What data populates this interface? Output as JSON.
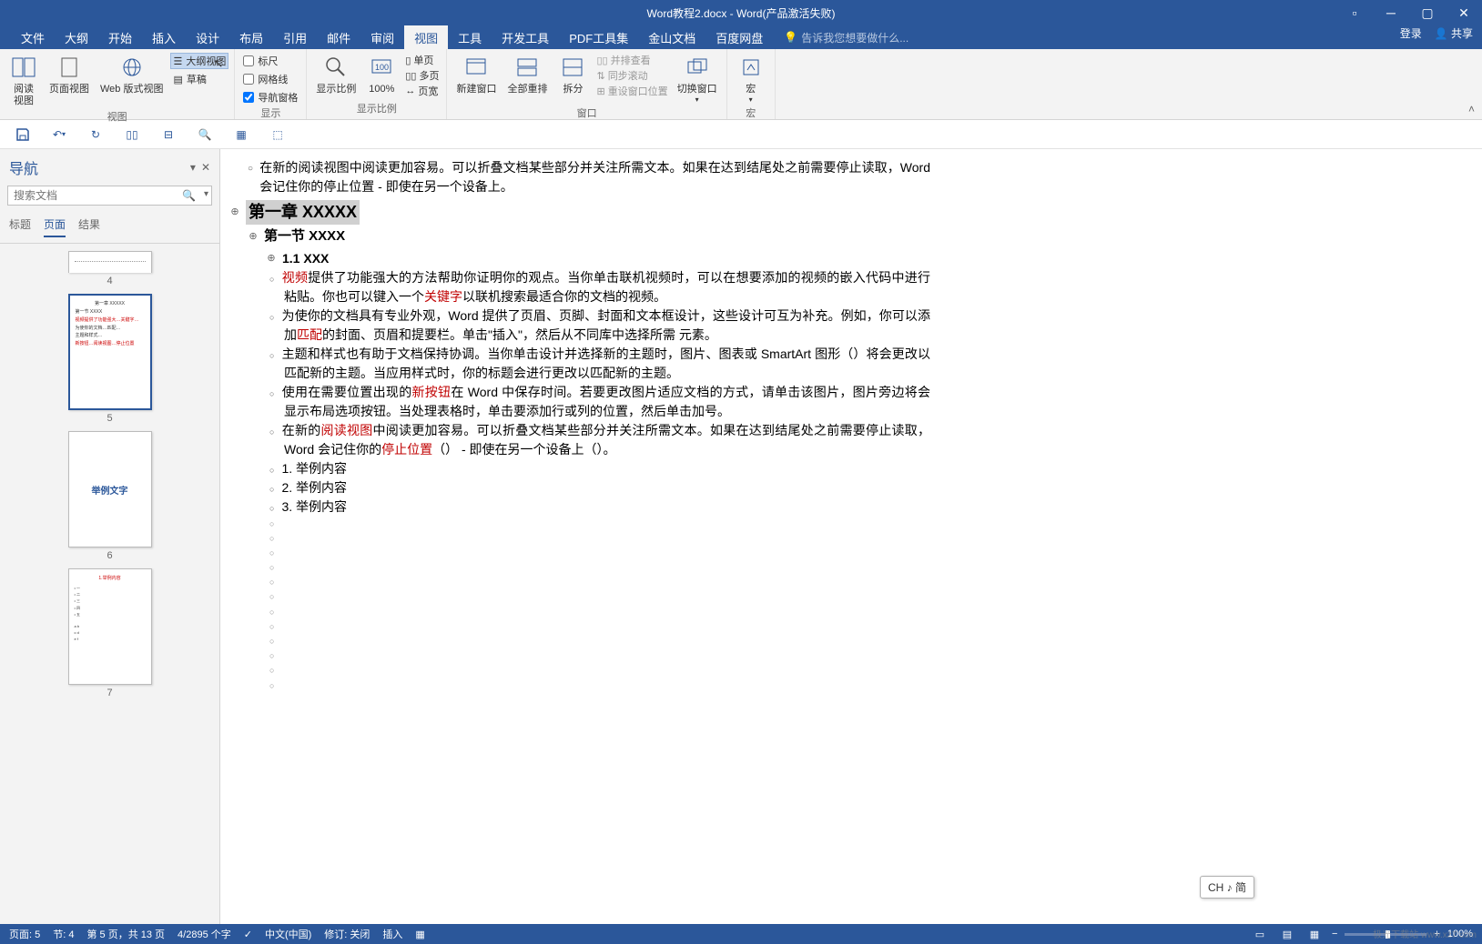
{
  "title_bar": {
    "doc_title": "Word教程2.docx - Word(产品激活失败)"
  },
  "menu": {
    "tabs": [
      "文件",
      "大纲",
      "开始",
      "插入",
      "设计",
      "布局",
      "引用",
      "邮件",
      "审阅",
      "视图",
      "工具",
      "开发工具",
      "PDF工具集",
      "金山文档",
      "百度网盘"
    ],
    "active_index": 9,
    "search_placeholder": "告诉我您想要做什么...",
    "login": "登录",
    "share": "共享"
  },
  "ribbon": {
    "groups": {
      "view": {
        "label": "视图",
        "reading": "阅读\n视图",
        "page": "页面视图",
        "web": "Web 版式视图",
        "outline": "大纲视图",
        "draft": "草稿"
      },
      "show": {
        "label": "显示",
        "ruler": "标尺",
        "gridlines": "网格线",
        "nav_pane": "导航窗格"
      },
      "zoom": {
        "label": "显示比例",
        "zoom": "显示比例",
        "p100": "100%",
        "single": "单页",
        "multi": "多页",
        "width": "页宽"
      },
      "window": {
        "label": "窗口",
        "new": "新建窗口",
        "all": "全部重排",
        "split": "拆分",
        "side": "并排查看",
        "sync": "同步滚动",
        "reset": "重设窗口位置",
        "switch": "切换窗口"
      },
      "macro": {
        "label": "宏",
        "macro": "宏"
      }
    }
  },
  "nav": {
    "title": "导航",
    "search_placeholder": "搜索文档",
    "tabs": [
      "标题",
      "页面",
      "结果"
    ],
    "active_tab": 1,
    "thumbs": [
      {
        "num": "4",
        "cut": true
      },
      {
        "num": "5",
        "selected": true,
        "preview": "red-text"
      },
      {
        "num": "6",
        "preview": "举例文字"
      },
      {
        "num": "7",
        "preview": "list"
      }
    ]
  },
  "doc": {
    "intro1": "在新的阅读视图中阅读更加容易。可以折叠文档某些部分并关注所需文本。如果在达到结尾处之前需要停止读取，Word 会记住你的停止位置 - 即使在另一个设备上。",
    "chapter": "第一章  XXXXX",
    "section": "第一节  XXXX",
    "subsection": "1.1 XXX",
    "kw_video": "视频",
    "kw_keyword": "关键字",
    "kw_match": "匹配",
    "kw_newbtn": "新按钮",
    "kw_readview": "阅读视图",
    "kw_stoppos": "停止位置",
    "p1a": "提供了功能强大的方法帮助你证明你的观点。当你单击联机视频时，可以在想要添加的视频的嵌入代码中进行粘贴。你也可以键入一个",
    "p1b": "以联机搜索最适合你的文档的视频。",
    "p2a": "为使你的文档具有专业外观，Word 提供了页眉、页脚、封面和文本框设计，这些设计可互为补充。例如，你可以添加",
    "p2b": "的封面、页眉和提要栏。单击\"插入\"，然后从不同库中选择所需 元素。",
    "p3": "主题和样式也有助于文档保持协调。当你单击设计并选择新的主题时，图片、图表或 SmartArt 图形（）将会更改以匹配新的主题。当应用样式时，你的标题会进行更改以匹配新的主题。",
    "p4a": "使用在需要位置出现的",
    "p4b": "在 Word 中保存时间。若要更改图片适应文档的方式，请单击该图片，图片旁边将会显示布局选项按钮。当处理表格时，单击要添加行或列的位置，然后单击加号。",
    "p5a": "在新的",
    "p5b": "中阅读更加容易。可以折叠文档某些部分并关注所需文本。如果在达到结尾处之前需要停止读取，Word 会记住你的",
    "p5c": "（） - 即使在另一个设备上（）。",
    "list": [
      "1. 举例内容",
      "2. 举例内容",
      "3. 举例内容"
    ]
  },
  "status": {
    "page": "页面: 5",
    "section": "节: 4",
    "page_of": "第 5 页，共 13 页",
    "words": "4/2895 个字",
    "lang": "中文(中国)",
    "track": "修订: 关闭",
    "insert": "插入",
    "zoom": "100%"
  },
  "ime": "CH ♪ 简",
  "watermark": "极光下载站 www.xz7.com"
}
